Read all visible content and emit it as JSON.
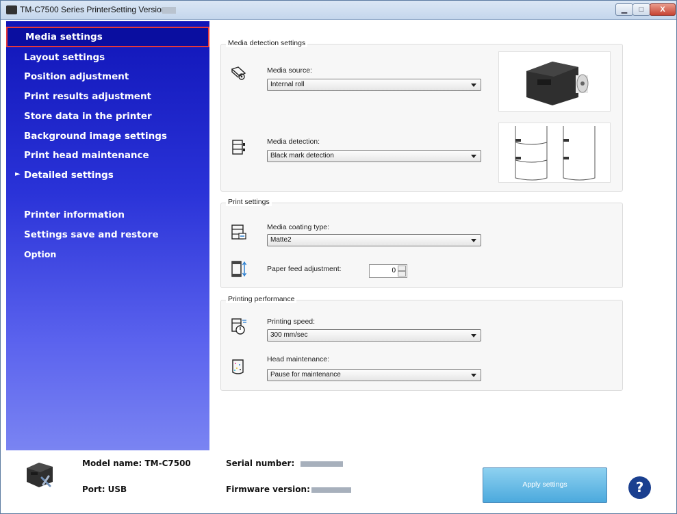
{
  "window": {
    "title": "TM-C7500 Series PrinterSetting Version",
    "controls": {
      "minimize": "▁",
      "maximize": "□",
      "close": "X"
    }
  },
  "sidebar": {
    "items": [
      {
        "label": "Media settings",
        "selected": true
      },
      {
        "label": "Layout settings"
      },
      {
        "label": "Position adjustment"
      },
      {
        "label": "Print results adjustment"
      },
      {
        "label": "Store data in the printer"
      },
      {
        "label": "Background image settings"
      },
      {
        "label": "Print head maintenance"
      },
      {
        "label": "Detailed settings",
        "collapsed_arrow": "►"
      },
      {
        "label": "Printer information"
      },
      {
        "label": "Settings save and restore"
      },
      {
        "label": "Option"
      }
    ]
  },
  "groups": {
    "media_detection": {
      "title": "Media detection settings",
      "media_source_label": "Media source:",
      "media_source_value": "Internal roll",
      "media_detection_label": "Media detection:",
      "media_detection_value": "Black mark detection"
    },
    "print_settings": {
      "title": "Print settings",
      "coating_label": "Media coating type:",
      "coating_value": "Matte2",
      "feed_label": "Paper feed adjustment:",
      "feed_value": "0"
    },
    "performance": {
      "title": "Printing performance",
      "speed_label": "Printing speed:",
      "speed_value": "300 mm/sec",
      "head_label": "Head maintenance:",
      "head_value": "Pause for maintenance"
    }
  },
  "footer": {
    "model": "Model name: TM-C7500",
    "port": "Port: USB",
    "serial_label": "Serial number:",
    "firmware_label": "Firmware version:",
    "apply_label": "Apply settings",
    "help_label": "?"
  },
  "colors": {
    "sidebar_top": "#1015b8",
    "sidebar_bottom": "#7a84f2",
    "selection_border": "#e5383b",
    "apply_button": "#4ba9dd",
    "help_button": "#1a3f8f"
  }
}
